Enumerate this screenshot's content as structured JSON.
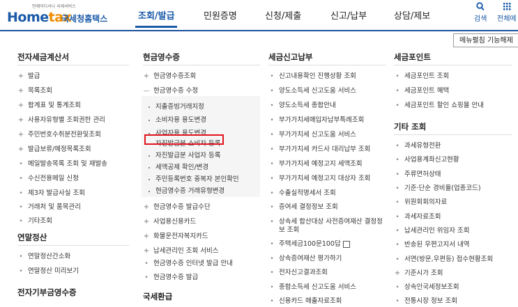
{
  "header": {
    "logo_tagline": "언제어디서나 국세서비스",
    "logo_main_a": "Home",
    "logo_main_b": "tax",
    "logo_korean": "국세청홈택스",
    "nav": [
      "조회/발급",
      "민원증명",
      "신청/제출",
      "신고/납부",
      "상담/제보"
    ],
    "search_label": "검색",
    "allmenu_label": "전체메"
  },
  "menu_toggle_button": "메뉴펼침 기능해제",
  "col1": {
    "title": "전자세금계산서",
    "items": [
      "발급",
      "목록조회",
      "합계표 및 통계조회",
      "사용자유형별 조회권한 관리",
      "주민번호수취분전환및조회",
      "발급보류/예정목록조회",
      "메일발송목록 조회 및 재발송",
      "수신전용메일 신청",
      "제3자 발급사실 조회",
      "거래처 및 품목관리",
      "기타조회"
    ],
    "title2": "연말정산",
    "items2": [
      "연말정산간소화",
      "연말정산 미리보기"
    ],
    "title3": "전자기부금영수증"
  },
  "col2": {
    "title": "현금영수증",
    "items_top": [
      "현금영수증조회",
      "현금영수증 수정"
    ],
    "sub_items": [
      "지출증빙거래지정",
      "소비자용 용도변경",
      "사업자용 용도변경",
      "자진발급분 소비자 등록",
      "자진발급분 사업자 등록",
      "세액공제 확인/변경",
      "주민등록번호 중복자 본인확인",
      "현금영수증 거래유형변경"
    ],
    "items_bottom": [
      "현금영수증 발급수단",
      "사업용신용카드",
      "화물운전자복지카드",
      "납세관리인 조회 서비스",
      "현금영수증 인터넷 발급 안내",
      "현금영수증 발급"
    ],
    "title2": "국세환급"
  },
  "col3": {
    "title": "세금신고납부",
    "items": [
      "신고내용확인 진행상황 조회",
      "양도소득세 신고도움 서비스",
      "양도소득세 종합안내",
      "부가가치세매입자납부특례조회",
      "부가가치세 신고도움 서비스",
      "부가가치세 카드사 대리납부 조회",
      "부가가치세 예정고지 세액조회",
      "부가가치세 예정고지 대상자 조회",
      "수출실적명세서 조회",
      "증여세 결정정보 조회",
      "상속세 합산대상 사전증여재산 결정정",
      "보 조회",
      "주택세금100문100답",
      "상속증여재산 평가하기",
      "전자신고결과조회",
      "종합소득세 신고도움 서비스",
      "신용카드 매출자료조회"
    ]
  },
  "col4": {
    "title": "세금포인트",
    "items": [
      "세금포인트 조회",
      "세금포인트 혜택",
      "세금포인트 할인 쇼핑몰 안내"
    ],
    "title2": "기타 조회",
    "items2": [
      "과세유형전환",
      "사업용계좌신고현황",
      "주류면허상태",
      "기준·단순 경비율(업종코드)",
      "위원회회의자료",
      "과세자료조회",
      "납세관리인 위임자 조회",
      "반송된 우편고지서 내역",
      "서면(방문,우편등) 접수현황조회",
      "기준시가 조회",
      "상속인국세정보조회",
      "전통시장 정보 조회"
    ]
  },
  "colors": {
    "brand_blue": "#1a5aa8",
    "accent_orange": "#f08c00",
    "highlight_red": "#e0141c"
  }
}
